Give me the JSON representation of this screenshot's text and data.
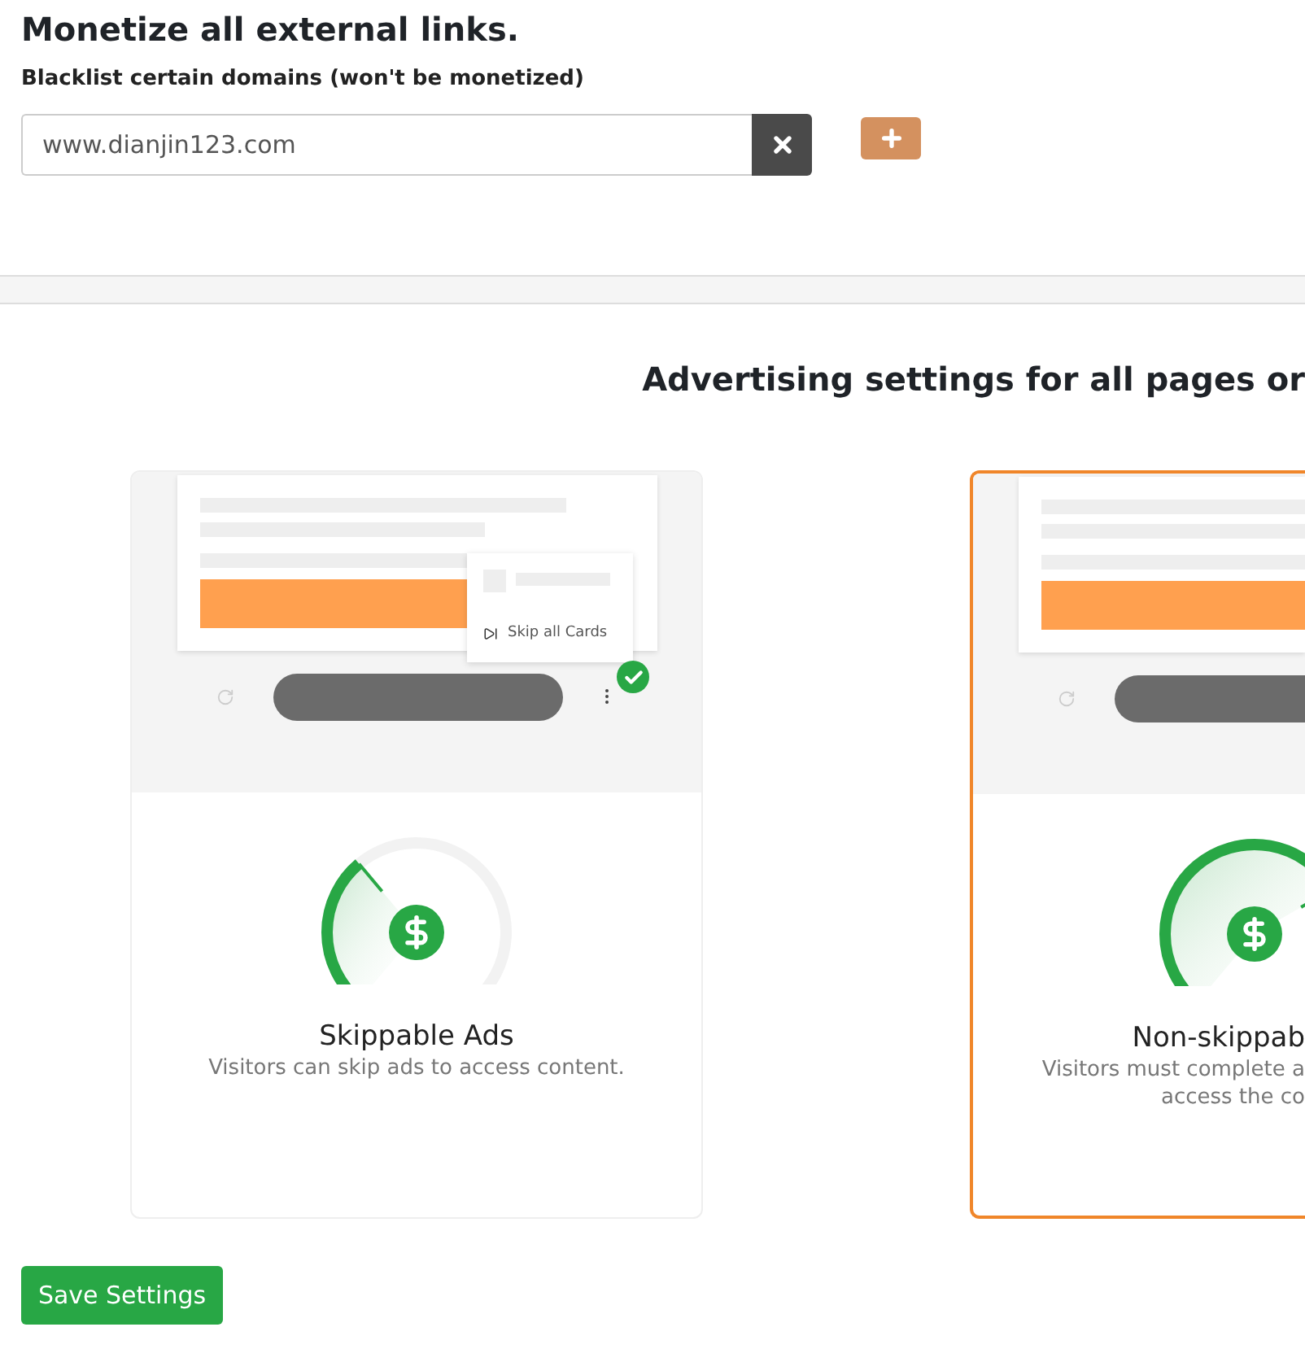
{
  "title": "Monetize all external links.",
  "blacklist": {
    "label": "Blacklist certain domains (won't be monetized)",
    "domains": [
      {
        "value": "www.dianjin123.com"
      }
    ]
  },
  "section_title": "Advertising settings for all pages or",
  "ad_types": [
    {
      "kind": "skippable",
      "selected": false,
      "menu_item": "Skip all Cards",
      "title": "Skippable Ads",
      "description": "Visitors can skip ads to access content."
    },
    {
      "kind": "non-skippable",
      "selected": true,
      "title": "Non-skippab",
      "description": "Visitors must complete a",
      "description_2": "access the co"
    }
  ],
  "save_button": "Save Settings"
}
